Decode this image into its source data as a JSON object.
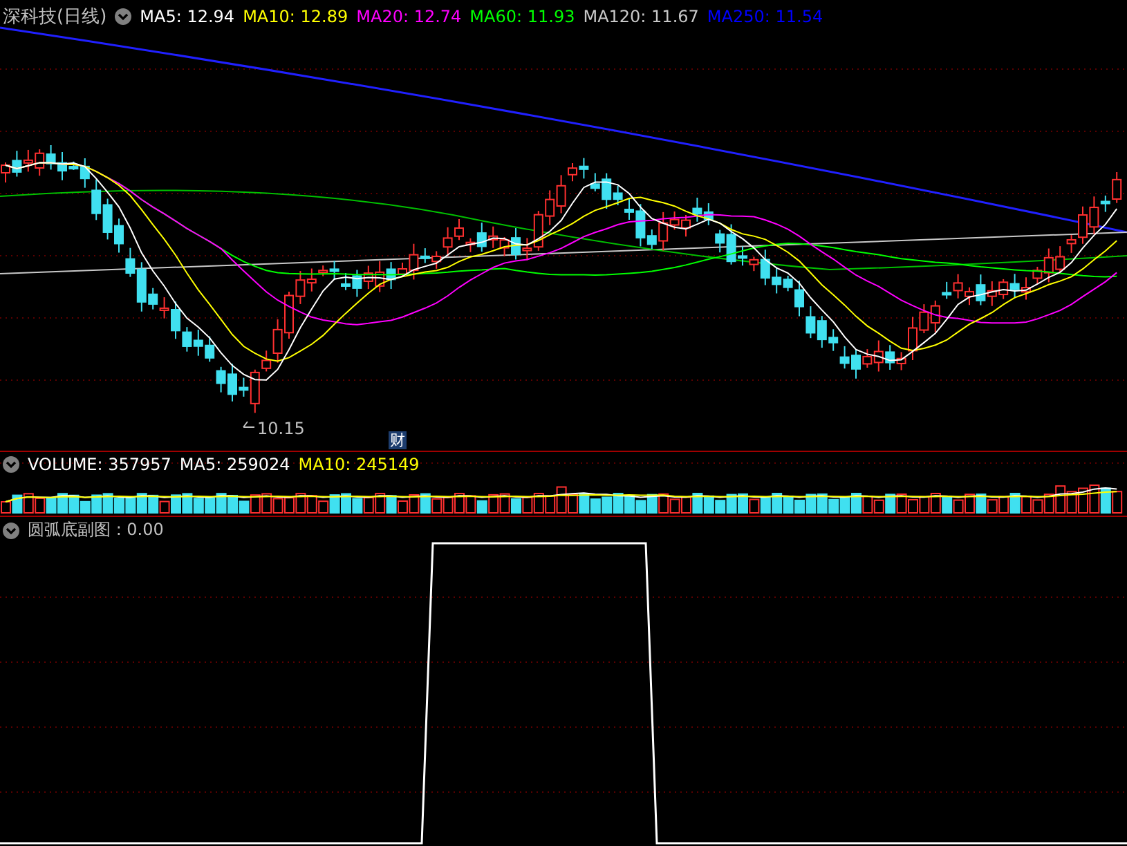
{
  "main_panel": {
    "title": "深科技(日线)",
    "indicators": [
      {
        "label": "MA5: 12.94",
        "color": "#ffffff"
      },
      {
        "label": "MA10: 12.89",
        "color": "#ffff00"
      },
      {
        "label": "MA20: 12.74",
        "color": "#ff00ff"
      },
      {
        "label": "MA60: 11.93",
        "color": "#00ff00"
      },
      {
        "label": "MA120: 11.67",
        "color": "#c8c8c8"
      },
      {
        "label": "MA250: 11.54",
        "color": "#0000ff"
      }
    ],
    "low_marker": "10.15",
    "news_badge": "财"
  },
  "volume_panel": {
    "indicators": [
      {
        "label": "VOLUME: 357957",
        "color": "#ffffff"
      },
      {
        "label": "MA5: 259024",
        "color": "#ffffff"
      },
      {
        "label": "MA10: 245149",
        "color": "#ffff00"
      }
    ]
  },
  "indicator_panel": {
    "label": "圆弧底副图 : 0.00"
  }
}
